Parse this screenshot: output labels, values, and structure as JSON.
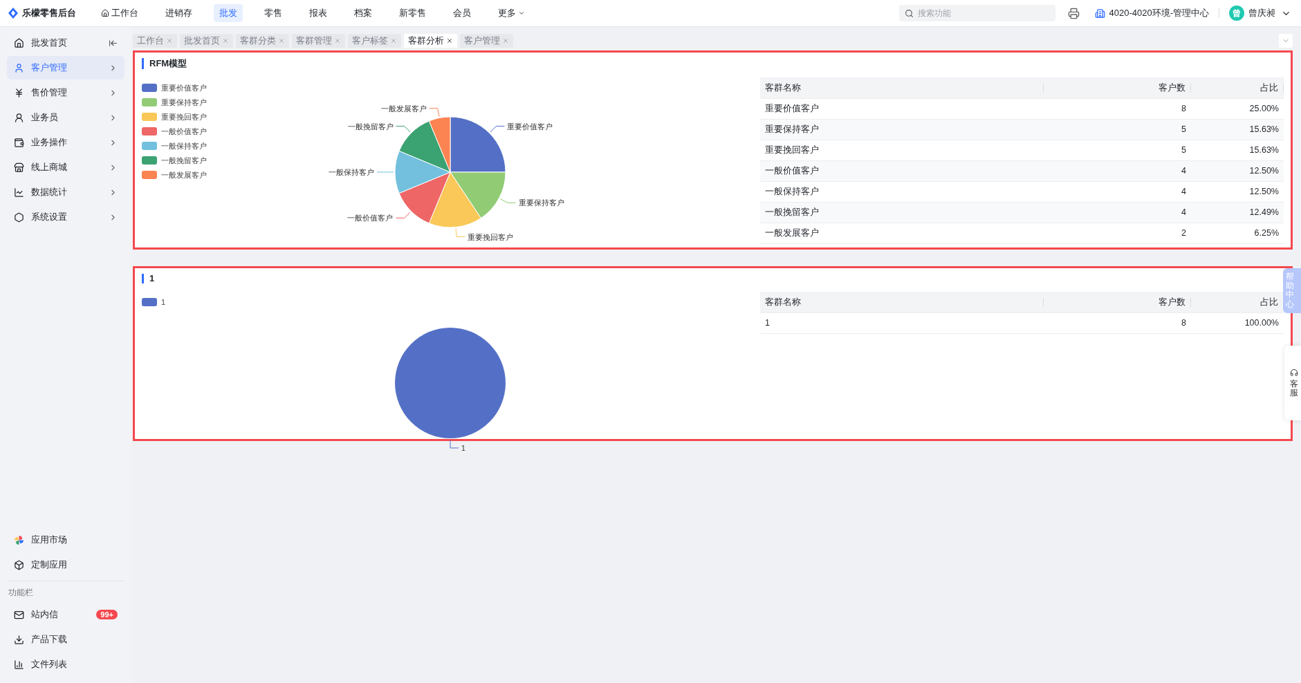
{
  "app": {
    "name": "乐檬零售后台"
  },
  "top_nav": [
    {
      "label": "工作台",
      "kind": "home",
      "selected": false
    },
    {
      "label": "进销存",
      "kind": "plain",
      "selected": false
    },
    {
      "label": "批发",
      "kind": "plain",
      "selected": true
    },
    {
      "label": "零售",
      "kind": "plain",
      "selected": false
    },
    {
      "label": "报表",
      "kind": "plain",
      "selected": false
    },
    {
      "label": "档案",
      "kind": "plain",
      "selected": false
    },
    {
      "label": "新零售",
      "kind": "plain",
      "selected": false
    },
    {
      "label": "会员",
      "kind": "plain",
      "selected": false
    },
    {
      "label": "更多",
      "kind": "dropdown",
      "selected": false
    }
  ],
  "search": {
    "placeholder": "搜索功能"
  },
  "org": "4020-4020环境-管理中心",
  "user": {
    "avatar": "曾",
    "name": "曾庆昶"
  },
  "sidebar": {
    "items": [
      {
        "label": "批发首页",
        "kind": "collapse",
        "selected": false
      },
      {
        "label": "客户管理",
        "kind": "nav",
        "selected": true
      },
      {
        "label": "售价管理",
        "kind": "nav",
        "selected": false
      },
      {
        "label": "业务员",
        "kind": "nav",
        "selected": false
      },
      {
        "label": "业务操作",
        "kind": "nav",
        "selected": false
      },
      {
        "label": "线上商城",
        "kind": "nav",
        "selected": false
      },
      {
        "label": "数据统计",
        "kind": "nav",
        "selected": false
      },
      {
        "label": "系统设置",
        "kind": "nav",
        "selected": false
      }
    ],
    "apps": [
      {
        "label": "应用市场"
      },
      {
        "label": "定制应用"
      }
    ],
    "section": "功能栏",
    "tools": [
      {
        "label": "站内信",
        "badge": "99+"
      },
      {
        "label": "产品下载"
      },
      {
        "label": "文件列表"
      }
    ]
  },
  "tabs": [
    {
      "label": "工作台",
      "selected": false
    },
    {
      "label": "批发首页",
      "selected": false
    },
    {
      "label": "客群分类",
      "selected": false
    },
    {
      "label": "客群管理",
      "selected": false
    },
    {
      "label": "客户标签",
      "selected": false
    },
    {
      "label": "客群分析",
      "selected": true
    },
    {
      "label": "客户管理",
      "selected": false
    }
  ],
  "panels": [
    {
      "title": "RFM模型",
      "highlighted": true,
      "legend": [
        {
          "label": "重要价值客户",
          "color": "#5470c6"
        },
        {
          "label": "重要保持客户",
          "color": "#91cc75"
        },
        {
          "label": "重要挽回客户",
          "color": "#fac858"
        },
        {
          "label": "一般价值客户",
          "color": "#ee6666"
        },
        {
          "label": "一般保持客户",
          "color": "#73c0de"
        },
        {
          "label": "一般挽留客户",
          "color": "#3ba272"
        },
        {
          "label": "一般发展客户",
          "color": "#fc8452"
        }
      ],
      "chart_data": {
        "type": "pie",
        "categories": [
          "重要价值客户",
          "重要保持客户",
          "重要挽回客户",
          "一般价值客户",
          "一般保持客户",
          "一般挽留客户",
          "一般发展客户"
        ],
        "values": [
          25,
          15.63,
          15.63,
          12.5,
          12.5,
          12.49,
          6.25
        ]
      },
      "table": {
        "columns": [
          "客群名称",
          "客户数",
          "占比"
        ],
        "rows": [
          [
            "重要价值客户",
            "8",
            "25.00%"
          ],
          [
            "重要保持客户",
            "5",
            "15.63%"
          ],
          [
            "重要挽回客户",
            "5",
            "15.63%"
          ],
          [
            "一般价值客户",
            "4",
            "12.50%"
          ],
          [
            "一般保持客户",
            "4",
            "12.50%"
          ],
          [
            "一般挽留客户",
            "4",
            "12.49%"
          ],
          [
            "一般发展客户",
            "2",
            "6.25%"
          ]
        ]
      }
    },
    {
      "title": "1",
      "highlighted": true,
      "legend": [
        {
          "label": "1",
          "color": "#5470c6"
        }
      ],
      "chart_data": {
        "type": "pie",
        "categories": [
          "1"
        ],
        "values": [
          100
        ]
      },
      "table": {
        "columns": [
          "客群名称",
          "客户数",
          "占比"
        ],
        "rows": [
          [
            "1",
            "8",
            "100.00%"
          ]
        ]
      }
    }
  ],
  "help_tab": "帮助中心",
  "service": "客服"
}
